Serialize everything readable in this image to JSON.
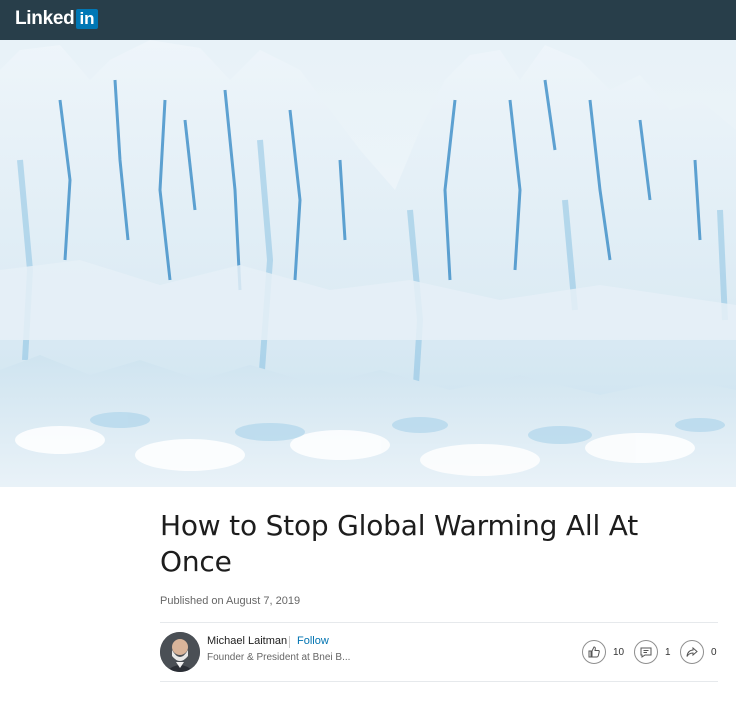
{
  "brand": {
    "word": "Linked",
    "in": "in"
  },
  "hero": {
    "description_icon": "glacier-photo"
  },
  "article": {
    "title": "How to Stop Global Warming All At Once",
    "published": "Published on August 7, 2019"
  },
  "author": {
    "name": "Michael Laitman",
    "follow_label": "Follow",
    "headline": "Founder & President at Bnei B..."
  },
  "social": {
    "likes": "10",
    "comments": "1",
    "shares": "0"
  },
  "colors": {
    "topbar": "#283e4a",
    "brand_blue": "#0077b5",
    "link_blue": "#0073b1"
  }
}
